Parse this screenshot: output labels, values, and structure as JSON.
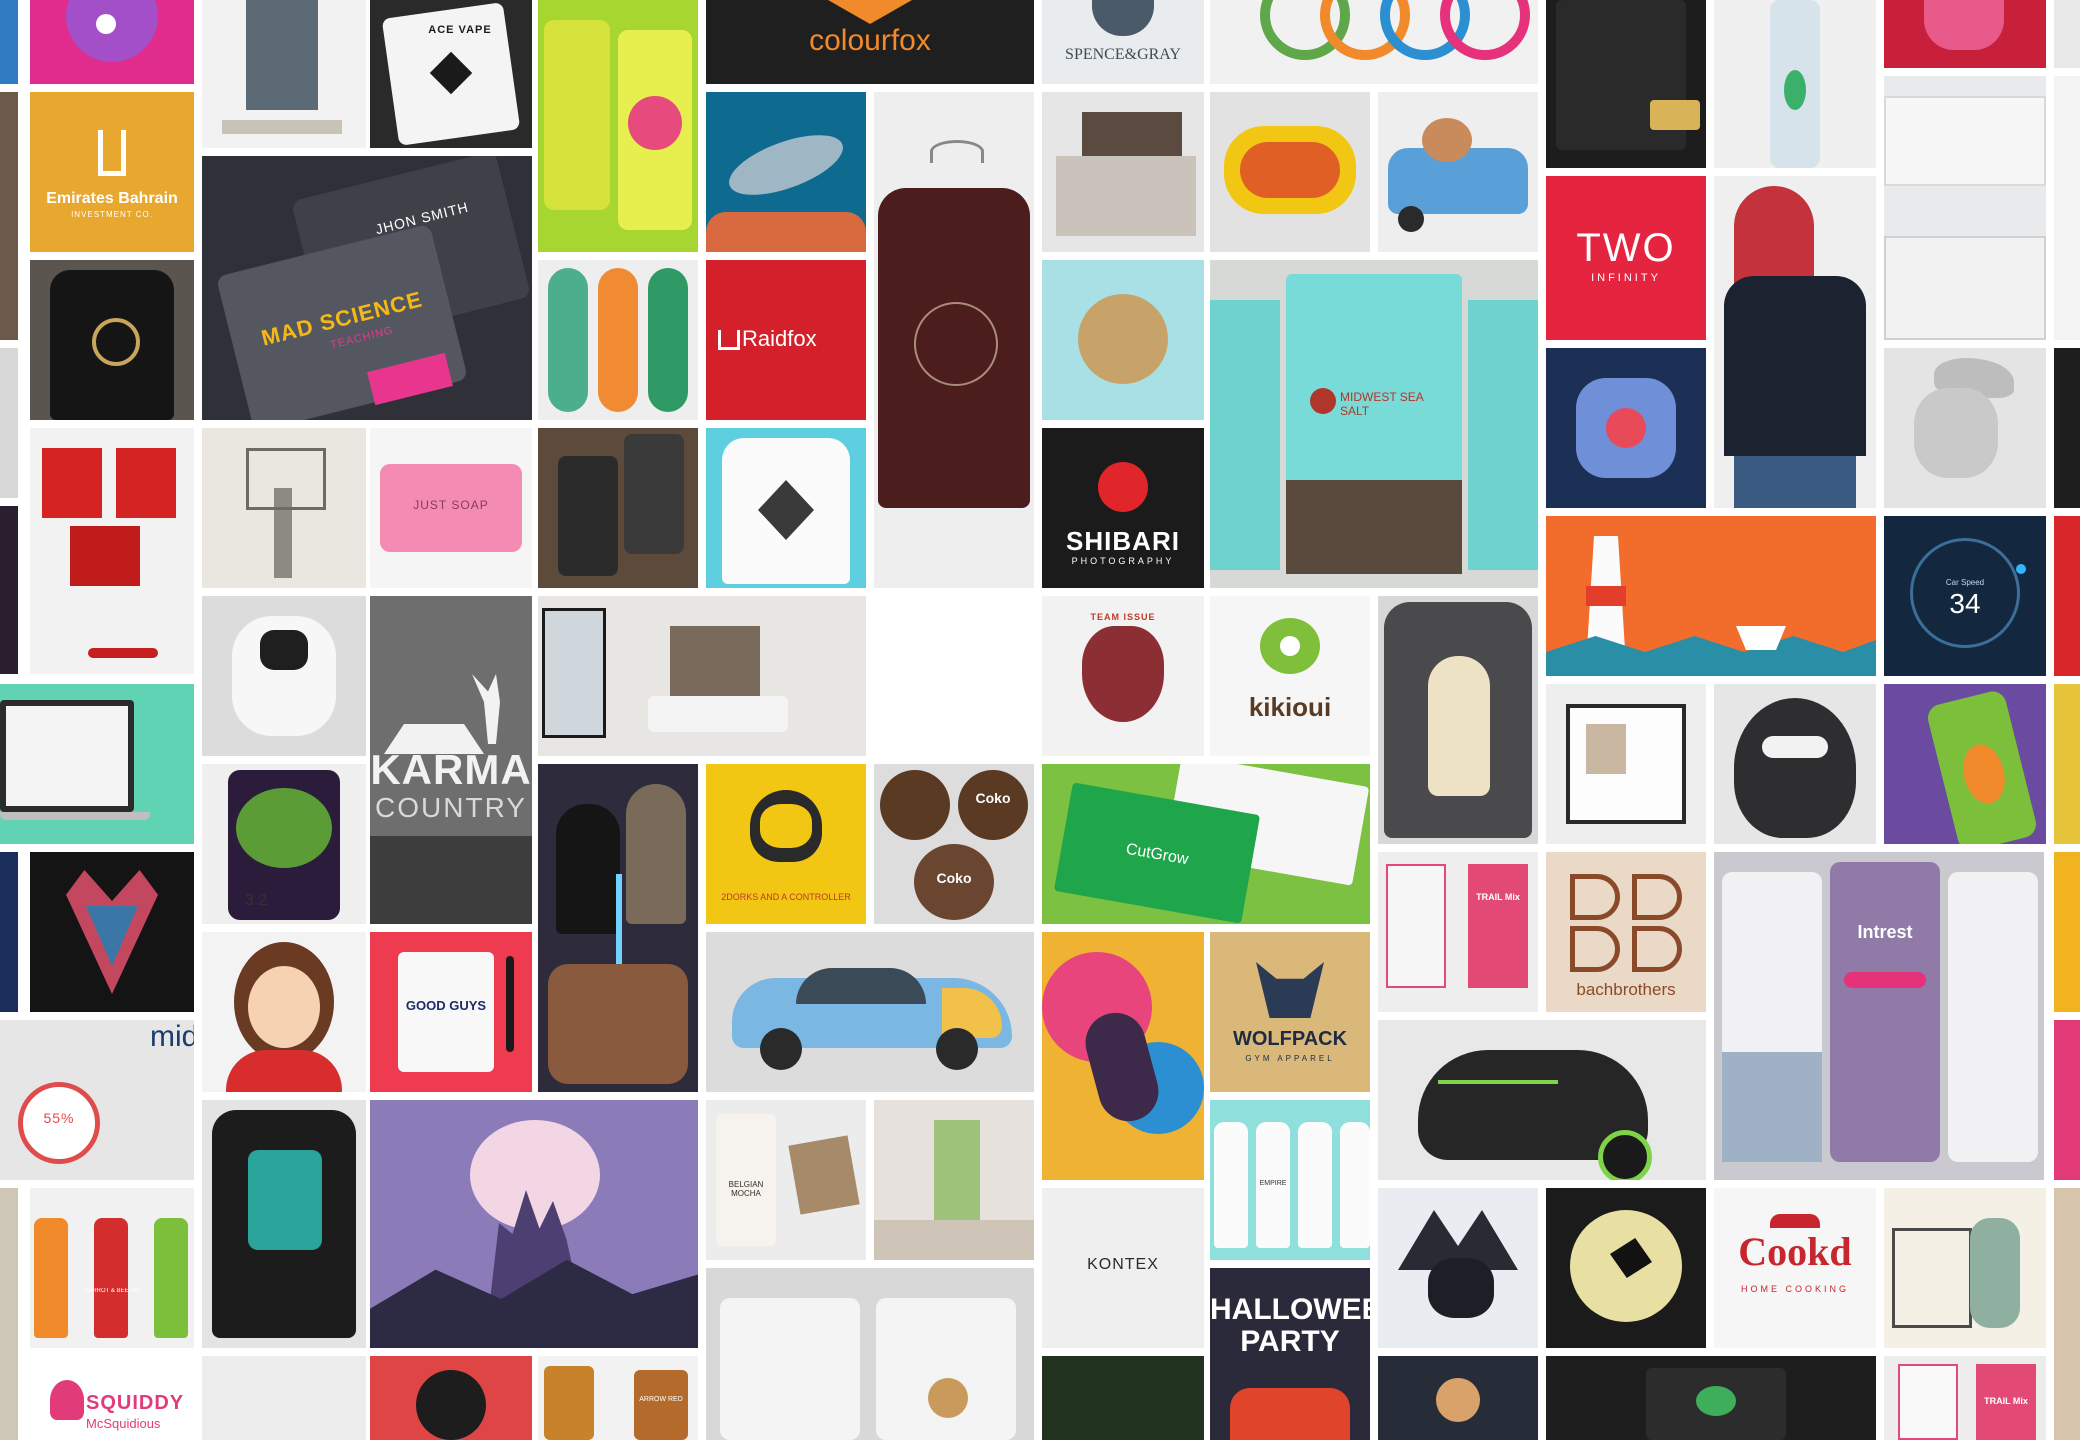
{
  "tiles": {
    "colourfox": "colourfox",
    "spence_gray": "SPENCE&GRAY",
    "ace_vape": "ACE VAPE",
    "emirates_bahrain": "Emirates Bahrain",
    "emirates_sub": "INVESTMENT CO.",
    "mad_science": "MAD SCIENCE",
    "mad_science_sub": "TEACHING",
    "business_card_name": "JHON SMITH",
    "raidfox": "Raidfox",
    "two_infinity": "TWO",
    "two_infinity_sub": "INFINITY",
    "shibari": "SHIBARI",
    "shibari_sub": "PHOTOGRAPHY",
    "midwest_sea_salt": "MIDWEST SEA SALT",
    "just_soap": "JUST SOAP",
    "karma_country": "KARMA",
    "karma_country_sub": "COUNTRY",
    "team_issue": "TEAM ISSUE",
    "kikioui": "kikioui",
    "car_speed_label": "Car Speed",
    "car_speed_value": "34",
    "dorks_controller": "2DORKS AND A CONTROLLER",
    "coko": "Coko",
    "cutgrow": "CutGrow",
    "bach_brothers": "bachbrothers",
    "intrest": "Intrest",
    "wolfpack": "WOLFPACK",
    "wolfpack_sub": "GYM APPAREL",
    "good_guys": "GOOD GUYS",
    "kontex": "KONTEX",
    "halloween_party": "HALLOWEEN PARTY",
    "cookd": "Cookd",
    "cookd_sub": "HOME COOKING",
    "squiddy": "SQUIDDY",
    "squiddy_sub": "McSquidious",
    "empire": "EMPIRE",
    "trail_mix": "TRAIL Mix",
    "belgian_mocha": "BELGIAN MOCHA",
    "percent_badge": "55%",
    "rating_value": "3.2",
    "carrot_beetroot": "CARROT & BEETROOT",
    "mid_label": "mid",
    "arrow_red": "ARROW RED"
  },
  "colors": {
    "emirates_bg": "#e8a72f",
    "raidfox_bg": "#d4202a",
    "two_infinity_bg": "#e5243f",
    "shibari_bg": "#1b1b1b",
    "midwest_bg": "#d7d9d6",
    "speed_bg": "#13273f",
    "dorks_bg": "#f2c714",
    "cutgrow_bg": "#7dc142",
    "wolfpack_bg": "#d9b87a",
    "good_guys_bg": "#ef3b4f",
    "cookd_red": "#c8262e",
    "teal_bg": "#5fd3b3",
    "lighthouse_bg": "#f26c2b"
  }
}
